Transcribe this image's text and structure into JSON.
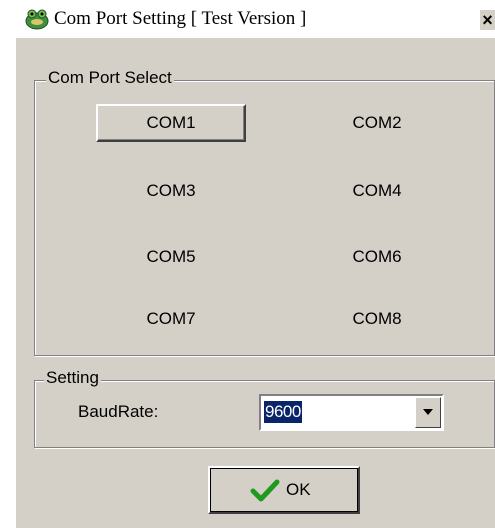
{
  "window": {
    "title": "Com Port Setting [ Test Version ]",
    "close_label": "×"
  },
  "com_port_select": {
    "label": "Com Port Select",
    "selected": "COM1",
    "ports": [
      "COM1",
      "COM2",
      "COM3",
      "COM4",
      "COM5",
      "COM6",
      "COM7",
      "COM8"
    ]
  },
  "setting": {
    "label": "Setting",
    "baud_label": "BaudRate:",
    "baud_value": "9600"
  },
  "ok_button": {
    "label": "OK"
  },
  "colors": {
    "window_bg": "#d4d0c8",
    "selection_bg": "#0a246a",
    "check_green": "#1e9b1e"
  }
}
